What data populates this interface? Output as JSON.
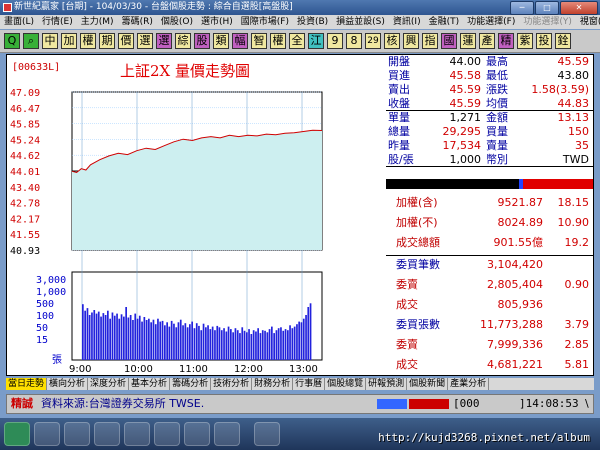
{
  "window": {
    "title": "新世紀贏家 [台期] - 104/03/30 - 台盤個股走勢 : 綜合自選股[高盤股]",
    "btn_min": "─",
    "btn_max": "□",
    "btn_close": "✕"
  },
  "menu": [
    {
      "label": "畫面(L)",
      "dim": false
    },
    {
      "label": "行情(E)",
      "dim": false
    },
    {
      "label": "主力(M)",
      "dim": false
    },
    {
      "label": "籌碼(R)",
      "dim": false
    },
    {
      "label": "個股(O)",
      "dim": false
    },
    {
      "label": "選市(H)",
      "dim": false
    },
    {
      "label": "國際市場(F)",
      "dim": false
    },
    {
      "label": "投資(B)",
      "dim": false
    },
    {
      "label": "損益並設(S)",
      "dim": false
    },
    {
      "label": "資訊(I)",
      "dim": false
    },
    {
      "label": "金融(T)",
      "dim": false
    },
    {
      "label": "功能選擇(F)",
      "dim": false
    },
    {
      "label": "功能選擇(Y)",
      "dim": true
    },
    {
      "label": "視窗(W)",
      "dim": false
    },
    {
      "label": "說明(H)",
      "dim": false
    }
  ],
  "toolbar": [
    {
      "label": "Q",
      "bg": "#38b038"
    },
    {
      "label": "⌕",
      "bg": "#38b038"
    },
    {
      "label": "中",
      "bg": "#f0e8a0"
    },
    {
      "label": "加",
      "bg": "#f0e8a0"
    },
    {
      "label": "權",
      "bg": "#f0e8a0"
    },
    {
      "label": "期",
      "bg": "#f0e8a0"
    },
    {
      "label": "價",
      "bg": "#f0e8a0"
    },
    {
      "label": "選",
      "bg": "#f0e8a0"
    },
    {
      "label": "選",
      "bg": "#c060c0"
    },
    {
      "label": "綜",
      "bg": "#f0e8a0"
    },
    {
      "label": "股",
      "bg": "#c060c0"
    },
    {
      "label": "類",
      "bg": "#f0e8a0"
    },
    {
      "label": "幅",
      "bg": "#c060c0"
    },
    {
      "label": "智",
      "bg": "#f0e8a0"
    },
    {
      "label": "權",
      "bg": "#f0e8a0"
    },
    {
      "label": "全",
      "bg": "#f0e8a0"
    },
    {
      "label": "江",
      "bg": "#40c0c0"
    },
    {
      "label": "9",
      "bg": "#f0e8a0"
    },
    {
      "label": "8",
      "bg": "#f0e8a0"
    },
    {
      "label": "29",
      "bg": "#f0e8a0"
    },
    {
      "label": "核",
      "bg": "#f0e8a0"
    },
    {
      "label": "興",
      "bg": "#f0e8a0"
    },
    {
      "label": "指",
      "bg": "#f0e8a0"
    },
    {
      "label": "國",
      "bg": "#c060c0"
    },
    {
      "label": "蓮",
      "bg": "#f0e8a0"
    },
    {
      "label": "產",
      "bg": "#f0e8a0"
    },
    {
      "label": "精",
      "bg": "#c060c0"
    },
    {
      "label": "紫",
      "bg": "#f0e8a0"
    },
    {
      "label": "投",
      "bg": "#f0e8a0"
    },
    {
      "label": "銓",
      "bg": "#f0e8a0"
    }
  ],
  "stock": {
    "code": "[00633L]",
    "title": "上証2X  量價走勢圖"
  },
  "chart_data": {
    "type": "line",
    "title": "上証2X  量價走勢圖",
    "price_ticks": [
      "47.09",
      "46.47",
      "45.85",
      "45.24",
      "44.62",
      "44.01",
      "43.40",
      "42.78",
      "42.17",
      "41.55",
      "40.93"
    ],
    "price_tick_colors": [
      "#d00000",
      "#d00000",
      "#d00000",
      "#d00000",
      "#d00000",
      "#d00000",
      "#d00000",
      "#d00000",
      "#d00000",
      "#d00000",
      "#000000"
    ],
    "volume_ticks": [
      "3,000",
      "1,000",
      "500",
      "100",
      "50",
      "15"
    ],
    "volume_unit": "張",
    "time_ticks": [
      "9:00",
      "10:00",
      "11:00",
      "12:00",
      "13:00"
    ],
    "ylim": [
      40.93,
      47.09
    ],
    "reference_price": 44.01,
    "price_series": {
      "x": [
        0,
        5,
        10,
        15,
        20,
        30,
        40,
        50,
        60,
        70,
        80,
        90,
        100,
        110,
        120,
        130,
        140,
        150,
        160,
        170,
        180,
        190,
        200,
        210,
        220,
        230,
        240,
        250,
        260,
        270
      ],
      "values": [
        44.0,
        43.95,
        44.1,
        44.05,
        44.25,
        44.45,
        44.6,
        44.7,
        44.65,
        44.8,
        44.9,
        44.85,
        45.0,
        45.15,
        45.25,
        45.2,
        45.3,
        45.35,
        45.3,
        45.4,
        45.35,
        45.4,
        45.38,
        45.45,
        45.42,
        45.48,
        45.5,
        45.55,
        45.6,
        45.59
      ]
    },
    "volume_series": {
      "values": [
        2200,
        900,
        1300,
        500,
        700,
        1000,
        600,
        800,
        400,
        650,
        500,
        900,
        300,
        700,
        450,
        600,
        300,
        550,
        400,
        1500,
        350,
        500,
        250,
        600,
        300,
        450,
        200,
        380,
        250,
        300,
        180,
        260,
        140,
        300,
        200,
        220,
        120,
        180,
        100,
        220,
        150,
        90,
        180,
        260,
        120,
        160,
        90,
        140,
        200,
        80,
        160,
        110,
        60,
        150,
        90,
        120,
        70,
        100,
        60,
        110,
        90,
        60,
        80,
        50,
        100,
        70,
        45,
        80,
        60,
        40,
        90,
        55,
        45,
        70,
        35,
        60,
        50,
        80,
        40,
        60,
        55,
        45,
        70,
        100,
        40,
        60,
        80,
        90,
        55,
        70,
        60,
        120,
        80,
        100,
        140,
        200,
        180,
        300,
        500,
        1500,
        2500
      ]
    }
  },
  "quote": {
    "rows": [
      {
        "l1": "開盤",
        "v1": "44.00",
        "l2": "最高",
        "v2": "45.59",
        "c1": "#000",
        "c2": "#d00000"
      },
      {
        "l1": "買進",
        "v1": "45.58",
        "l2": "最低",
        "v2": "43.80",
        "c1": "#d00000",
        "c2": "#000"
      },
      {
        "l1": "賣出",
        "v1": "45.59",
        "l2": "漲跌",
        "v2": "1.58(3.59)",
        "c1": "#d00000",
        "c2": "#d00000"
      },
      {
        "l1": "收盤",
        "v1": "45.59",
        "l2": "均價",
        "v2": "44.83",
        "c1": "#d00000",
        "c2": "#d00000"
      },
      {
        "l1": "單量",
        "v1": "1,271",
        "l2": "金額",
        "v2": "13.13",
        "c1": "#000",
        "c2": "#d00000"
      },
      {
        "l1": "總量",
        "v1": "29,295",
        "l2": "買量",
        "v2": "150",
        "c1": "#d00000",
        "c2": "#d00000"
      },
      {
        "l1": "昨量",
        "v1": "17,534",
        "l2": "賣量",
        "v2": "35",
        "c1": "#d00000",
        "c2": "#d00000"
      },
      {
        "l1": "股/張",
        "v1": "1,000",
        "l2": "幣別",
        "v2": "TWD",
        "c1": "#000",
        "c2": "#000"
      }
    ],
    "index_rows": [
      {
        "label": "加權(含)",
        "value": "9521.87",
        "change": "18.15"
      },
      {
        "label": "加權(不)",
        "value": "8024.89",
        "change": "10.90"
      },
      {
        "label": "成交總額",
        "value": "901.55億",
        "change": "19.2"
      }
    ],
    "order_rows": [
      {
        "label": "委買筆數",
        "value": "3,104,420",
        "change": ""
      },
      {
        "label": "委賣",
        "value": "2,805,404",
        "change": "0.90"
      },
      {
        "label": "成交",
        "value": "805,936",
        "change": ""
      },
      {
        "label": "委買張數",
        "value": "11,773,288",
        "change": "3.79"
      },
      {
        "label": "委賣",
        "value": "7,999,336",
        "change": "2.85"
      },
      {
        "label": "成交",
        "value": "4,681,221",
        "change": "5.81"
      }
    ]
  },
  "tabs": [
    {
      "label": "當日走勢",
      "active": true
    },
    {
      "label": "橫向分析",
      "active": false
    },
    {
      "label": "深度分析",
      "active": false
    },
    {
      "label": "基本分析",
      "active": false
    },
    {
      "label": "籌碼分析",
      "active": false
    },
    {
      "label": "技術分析",
      "active": false
    },
    {
      "label": "財務分析",
      "active": false
    },
    {
      "label": "行事曆",
      "active": false
    },
    {
      "label": "個股總覽",
      "active": false
    },
    {
      "label": "研報預測",
      "active": false
    },
    {
      "label": "個股新聞",
      "active": false
    },
    {
      "label": "產業分析",
      "active": false
    }
  ],
  "ticker": {
    "tag": "精誠",
    "source": "資料來源:台灣證券交易所 TWSE.",
    "code": "[000",
    "time": "]14:08:53",
    "arrow": "\\"
  },
  "watermark": "http://kujd3268.pixnet.net/album"
}
